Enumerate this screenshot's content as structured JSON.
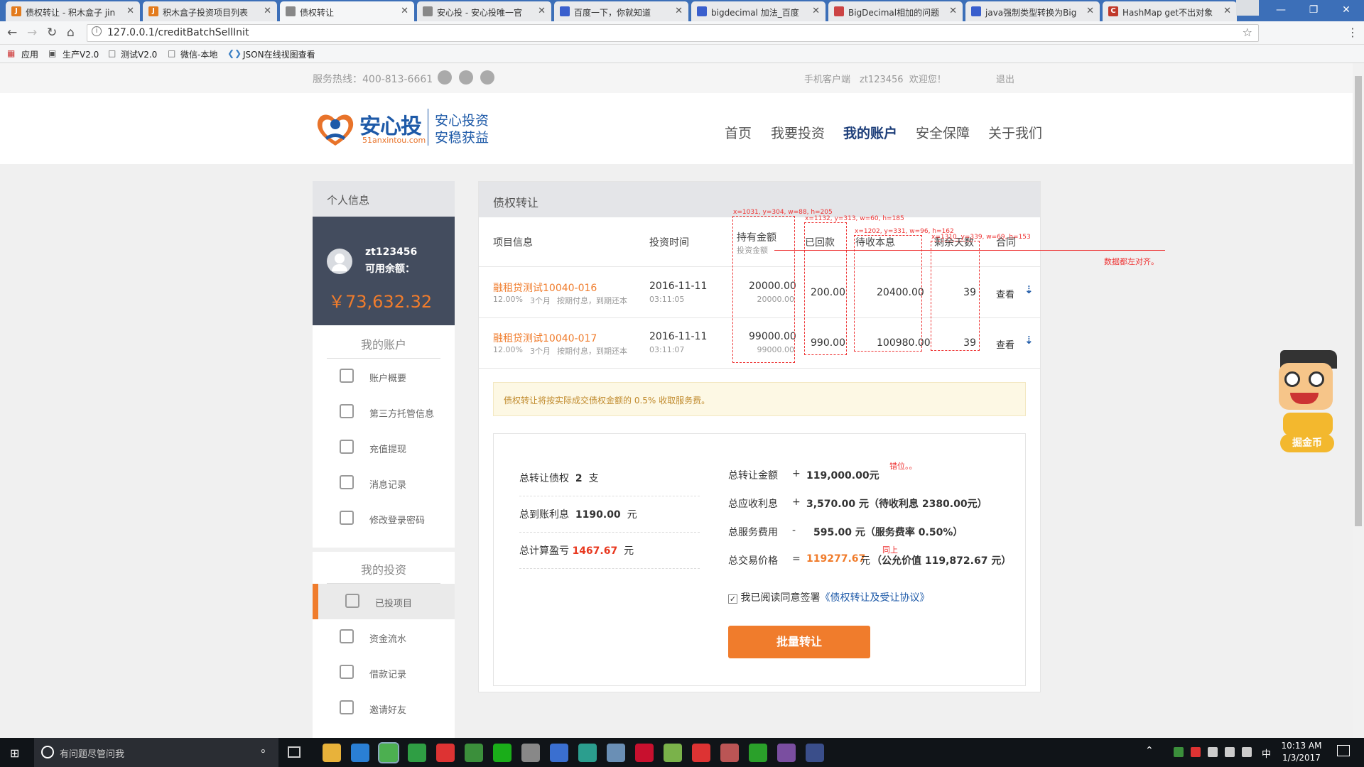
{
  "browser": {
    "tabs": [
      {
        "title": "债权转让 - 积木盒子 jin",
        "icon": "J",
        "color": "#e37b1d",
        "active": false
      },
      {
        "title": "积木盒子投资项目列表",
        "icon": "J",
        "color": "#e37b1d",
        "active": false
      },
      {
        "title": "债权转让",
        "icon": "doc",
        "color": "#888",
        "active": true
      },
      {
        "title": "安心投 - 安心投唯一官",
        "icon": "doc",
        "color": "#888",
        "active": false
      },
      {
        "title": "百度一下，你就知道",
        "icon": "paw",
        "color": "#3a5fcd",
        "active": false
      },
      {
        "title": "bigdecimal 加法_百度",
        "icon": "paw",
        "color": "#3a5fcd",
        "active": false
      },
      {
        "title": "BigDecimal相加的问题",
        "icon": "grid",
        "color": "#c44",
        "active": false
      },
      {
        "title": "java强制类型转换为Big",
        "icon": "paw",
        "color": "#3a5fcd",
        "active": false
      },
      {
        "title": "HashMap get不出对象",
        "icon": "C",
        "color": "#c0392b",
        "active": false
      }
    ],
    "url": "127.0.0.1/creditBatchSellInit",
    "bookmarks": [
      "应用",
      "生产V2.0",
      "测试V2.0",
      "微信-本地",
      "JSON在线视图查看"
    ]
  },
  "topbar": {
    "hotline": "服务热线：400-813-6661",
    "mobile": "手机客户端",
    "welcome": "zt123456  欢迎您！",
    "logout": "退出"
  },
  "header": {
    "logo_main": "安心投",
    "logo_sub": "51anxintou.com",
    "slogan1": "安心投资",
    "slogan2": "安稳获益",
    "nav": [
      "首页",
      "我要投资",
      "我的账户",
      "安全保障",
      "关于我们"
    ],
    "active_nav": "我的账户"
  },
  "sidebar": {
    "section_title": "个人信息",
    "username": "zt123456",
    "balance_label": "可用余额：",
    "balance": "￥73,632.32",
    "account_title": "我的账户",
    "account_items": [
      "账户概要",
      "第三方托管信息",
      "充值提现",
      "消息记录",
      "修改登录密码"
    ],
    "invest_title": "我的投资",
    "invest_items": [
      "已投项目",
      "资金流水",
      "借款记录",
      "邀请好友"
    ],
    "active_item": "已投项目"
  },
  "panel": {
    "title": "债权转让",
    "headers": {
      "project": "项目信息",
      "time": "投资时间",
      "holding": "持有金额",
      "holding_sub": "投资金额",
      "received": "已回款",
      "pending": "待收本息",
      "days": "剩余天数",
      "contract": "合同"
    },
    "rows": [
      {
        "name": "融租贷测试10040-016",
        "rate": "12.00%",
        "term": "3个月",
        "method": "按期付息，到期还本",
        "date": "2016-11-11",
        "time": "03:11:05",
        "holding": "20000.00",
        "invest": "20000.00",
        "received": "200.00",
        "pending": "20400.00",
        "days": "39",
        "view": "查看"
      },
      {
        "name": "融租贷测试10040-017",
        "rate": "12.00%",
        "term": "3个月",
        "method": "按期付息，到期还本",
        "date": "2016-11-11",
        "time": "03:11:07",
        "holding": "99000.00",
        "invest": "99000.00",
        "received": "990.00",
        "pending": "100980.00",
        "days": "39",
        "view": "查看"
      }
    ],
    "notice": "债权转让将按实际成交债权金额的 0.5% 收取服务费。",
    "summary_left": {
      "count_label": "总转让债权",
      "count": "2",
      "count_unit": "支",
      "interest_label": "总到账利息",
      "interest": "1190.00",
      "interest_unit": "元",
      "profit_label": "总计算盈亏",
      "profit": "1467.67",
      "profit_unit": "元"
    },
    "summary_right": {
      "amount_label": "总转让金额",
      "amount_sign": "+",
      "amount": "119,000.00元",
      "recv_label": "总应收利息",
      "recv_sign": "+",
      "recv": "3,570.00 元（待收利息 2380.00元）",
      "fee_label": "总服务费用",
      "fee_sign": "-",
      "fee": "595.00 元（服务费率 0.50%）",
      "price_label": "总交易价格",
      "price_sign": "=",
      "price": "119277.67",
      "price_unit": "元",
      "fair": "（公允价值 119,872.67 元）"
    },
    "agree_text": "我已阅读同意签署",
    "agree_link": "《债权转让及受让协议》",
    "submit": "批量转让"
  },
  "annotations": {
    "box1": "x=1031, y=304, w=88, h=205",
    "box2": "x=1132, y=313, w=60, h=185",
    "box3": "x=1202, y=331, w=96, h=162",
    "box4": "x=1310, y=339, w=69, h=153",
    "note_align": "数据都左对齐。",
    "note_misplace": "错位。。",
    "note_same": "同上"
  },
  "mascot": {
    "label": "掘金币"
  },
  "taskbar": {
    "search_placeholder": "有问题尽管问我",
    "time": "10:13 AM",
    "date": "1/3/2017",
    "ime": "中"
  }
}
